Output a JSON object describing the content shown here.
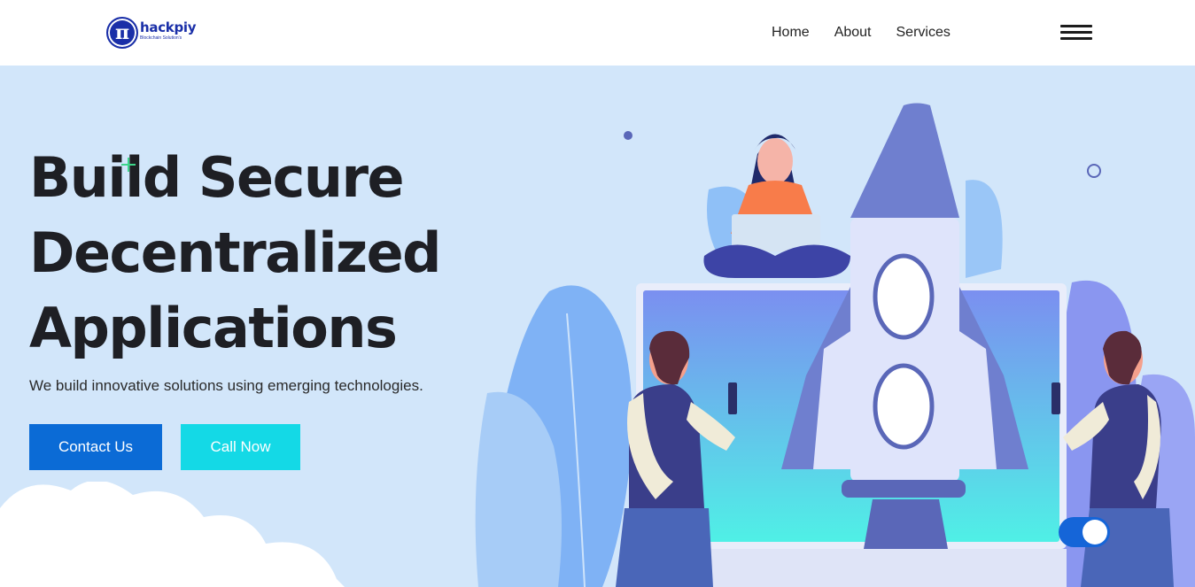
{
  "header": {
    "logo": {
      "glyph": "π",
      "name": "hackpiy",
      "tagline": "Blockchain Solution's"
    },
    "nav": [
      {
        "label": "Home"
      },
      {
        "label": "About"
      },
      {
        "label": "Services"
      }
    ],
    "menu_icon": "hamburger-menu-icon"
  },
  "hero": {
    "title_lines": [
      "Build Secure",
      "Decentralized",
      "Applications"
    ],
    "subtitle": "We build innovative solutions using emerging technologies.",
    "contact_label": "Contact Us",
    "call_label": "Call Now"
  },
  "colors": {
    "brand": "#1a2fa8",
    "primary_button": "#0b6bd6",
    "secondary_button": "#14d9e6",
    "hero_bg": "#d2e6fa"
  },
  "toggle": {
    "state": "on"
  }
}
